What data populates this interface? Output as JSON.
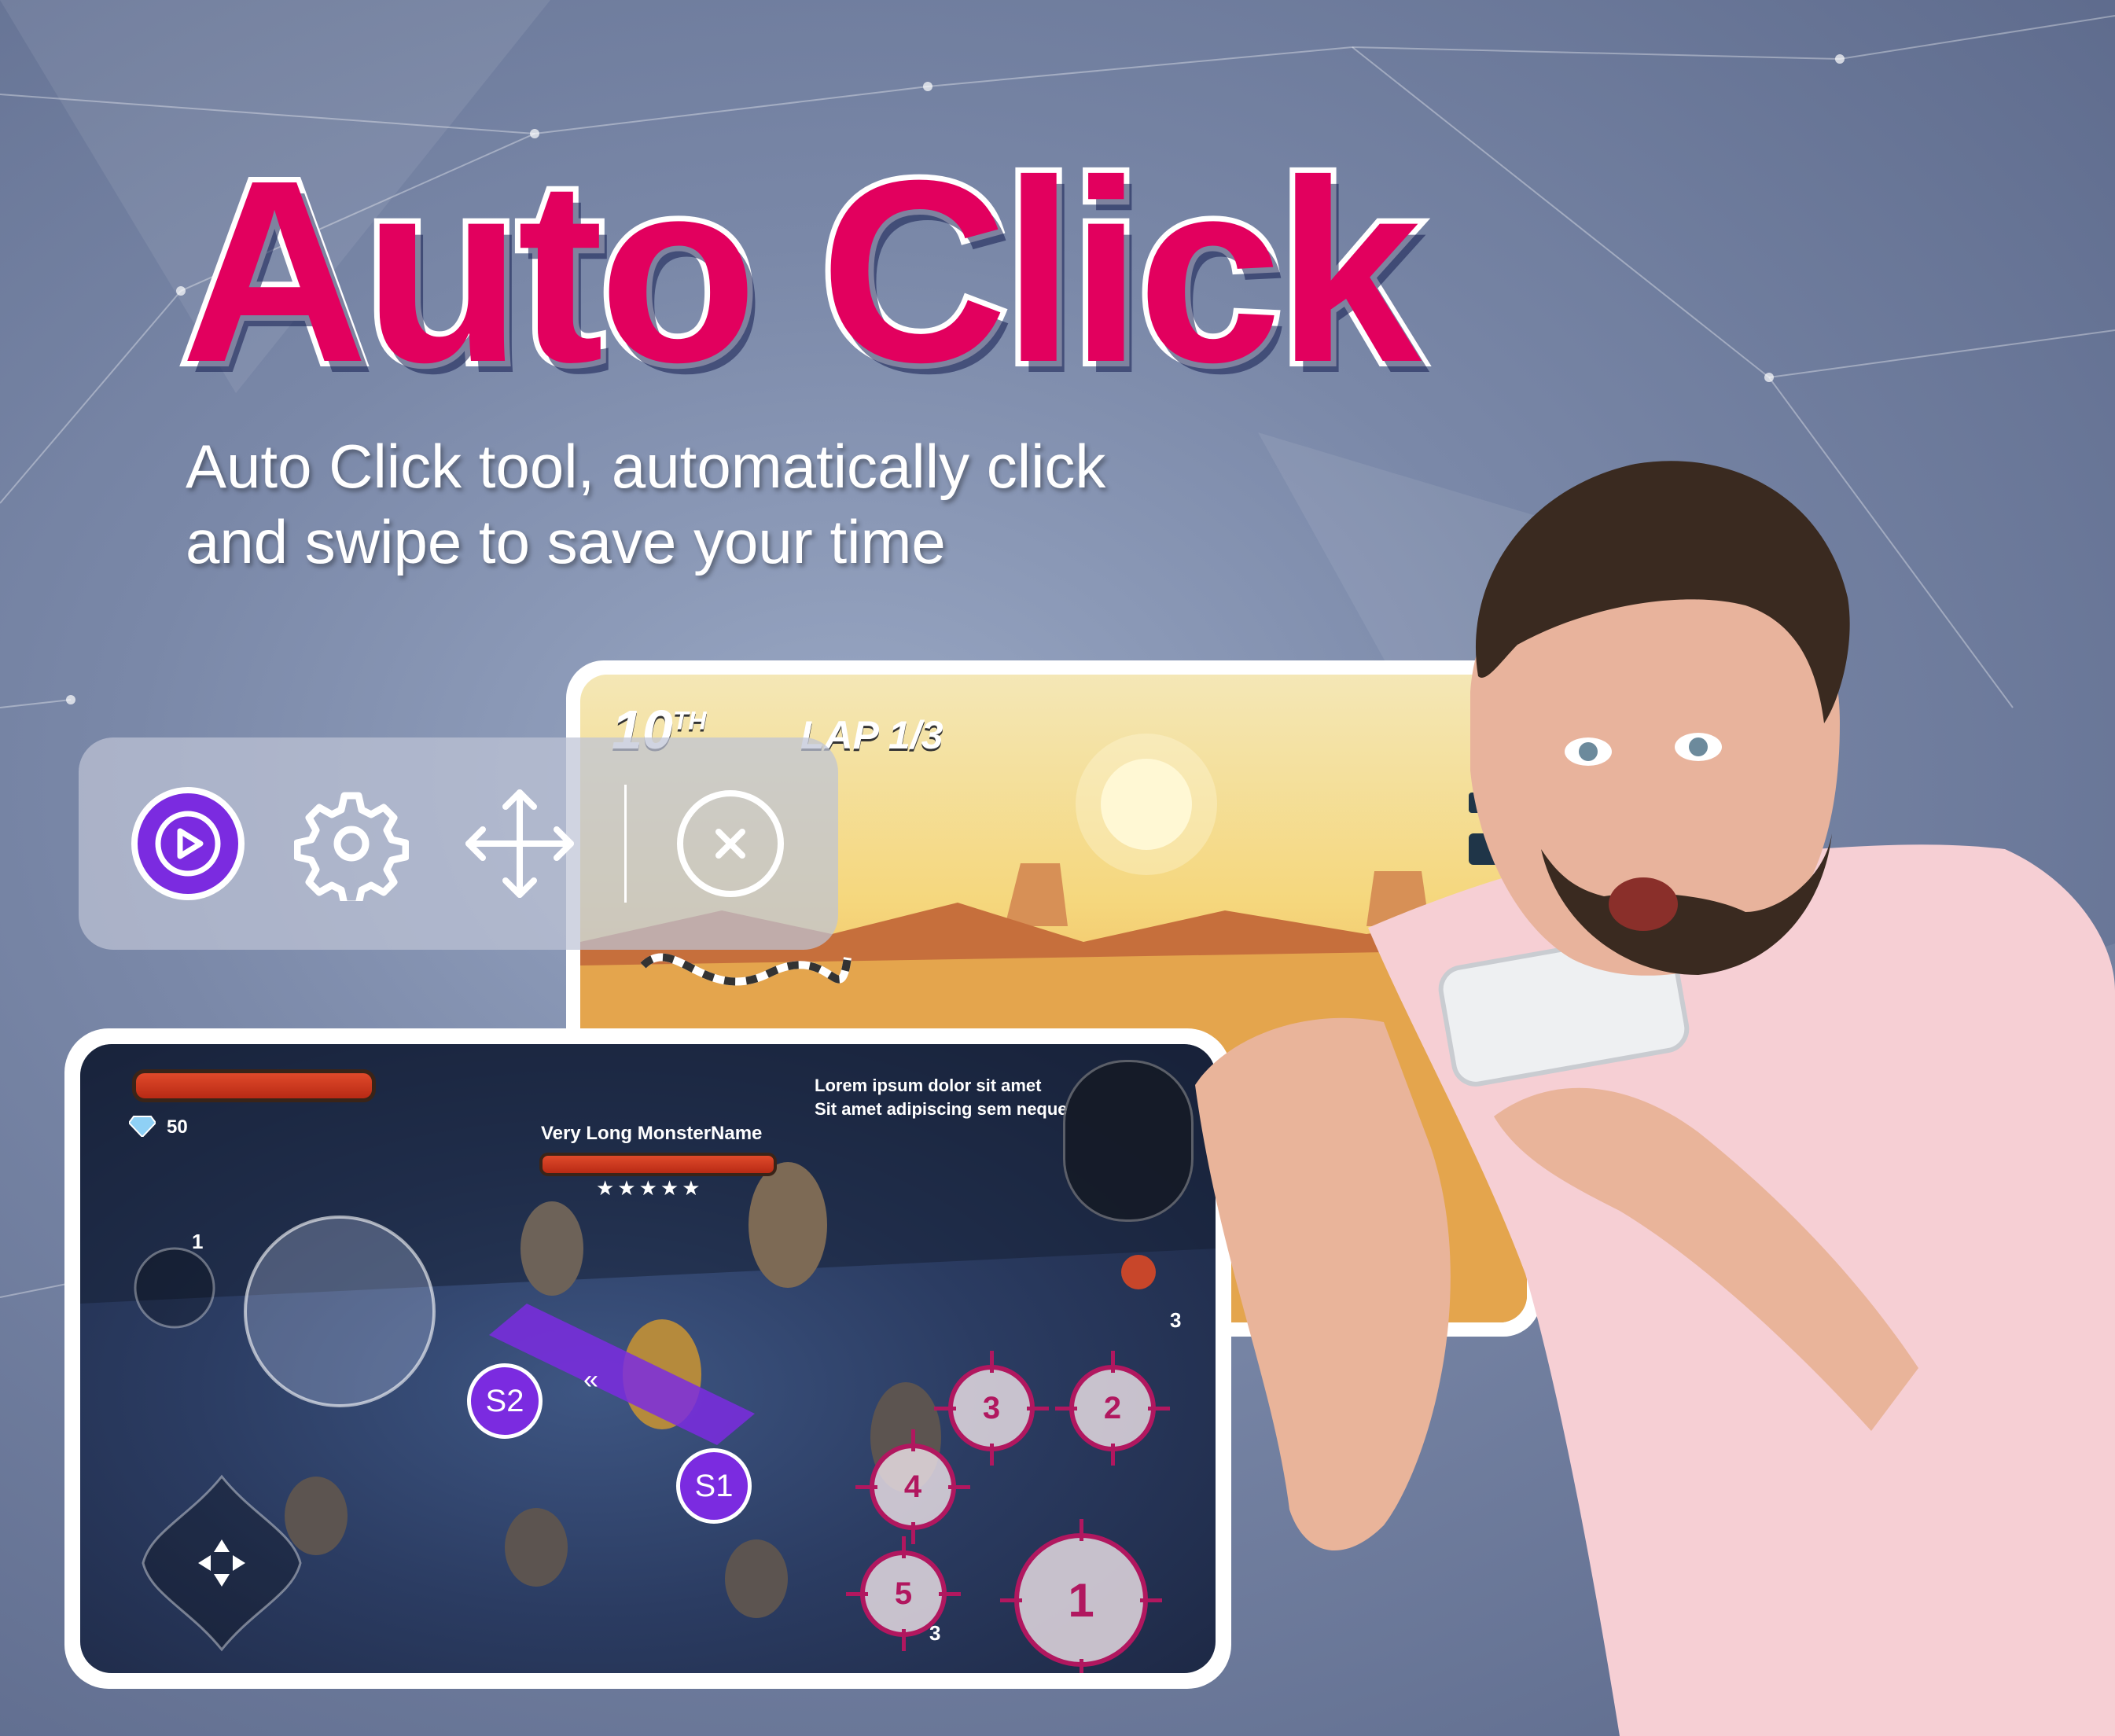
{
  "headline": {
    "title": "Auto Click",
    "subtitle_line1": "Auto Click tool, automatically click",
    "subtitle_line2": "and swipe to save your time"
  },
  "colors": {
    "title": "#e2005e",
    "play_button": "#7b2be0",
    "target_marker": "#b1175f",
    "swipe_marker": "#7b2be0"
  },
  "toolbar": {
    "buttons": [
      {
        "icon": "play-icon"
      },
      {
        "icon": "gear-icon"
      },
      {
        "icon": "move-arrows-icon"
      },
      {
        "icon": "close-circle-icon"
      }
    ]
  },
  "race_game": {
    "position": "10",
    "position_suffix": "TH",
    "lap": "LAP 1/3"
  },
  "rpg_game": {
    "gems": "50",
    "monster_name": "Very Long MonsterName",
    "quest_line1": "Lorem ipsum dolor sit amet",
    "quest_line2": "Sit amet adipiscing sem neque",
    "skill_count": "1",
    "potion_count": "3",
    "skill5_count": "3"
  },
  "markers": {
    "swipe_start": "S1",
    "swipe_end": "S2",
    "targets": [
      "1",
      "2",
      "3",
      "4",
      "5"
    ]
  }
}
